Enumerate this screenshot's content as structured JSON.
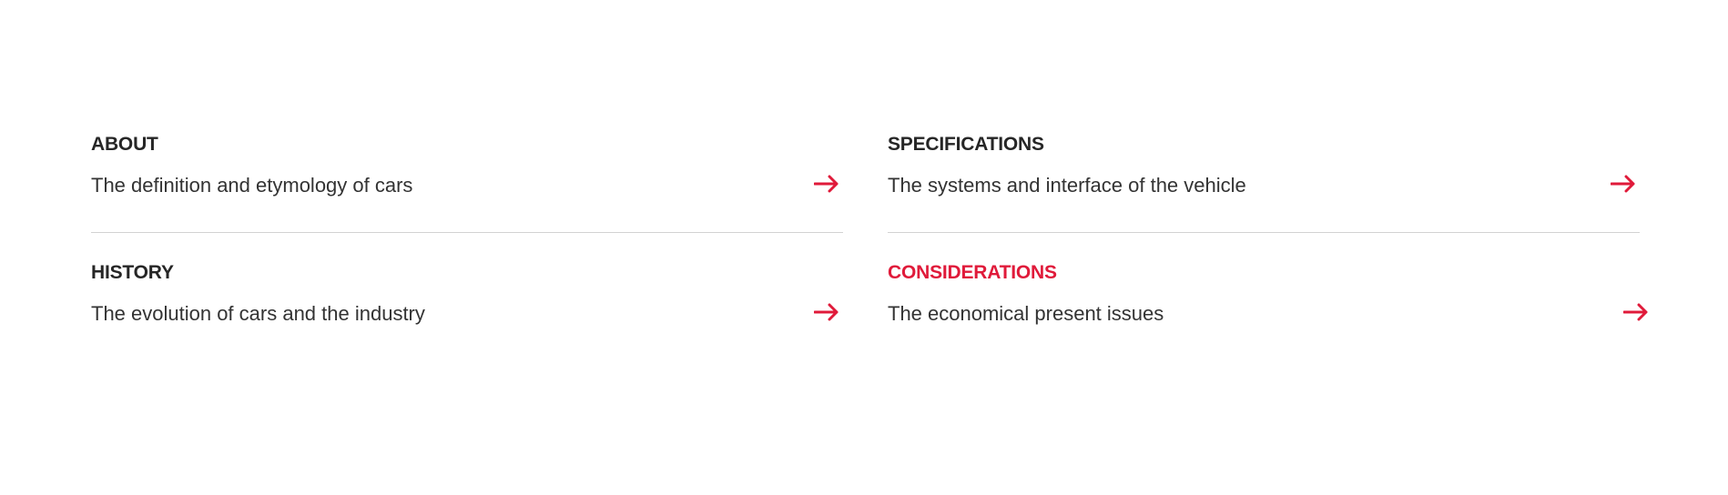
{
  "sections": [
    {
      "id": "about",
      "title": "ABOUT",
      "description": "The definition and etymology of cars",
      "icon": "arrow-right-icon",
      "active": false
    },
    {
      "id": "specifications",
      "title": "SPECIFICATIONS",
      "description": "The systems and interface of the vehicle",
      "icon": "arrow-right-icon",
      "active": false
    },
    {
      "id": "history",
      "title": "HISTORY",
      "description": "The evolution of cars and the industry",
      "icon": "arrow-right-icon",
      "active": false
    },
    {
      "id": "considerations",
      "title": "CONSIDERATIONS",
      "description": "The economical present issues",
      "icon": "arrow-right-icon",
      "active": true
    }
  ],
  "colors": {
    "accent": "#e01a3a",
    "text": "#2a2a2a",
    "divider": "#d2d2d2",
    "background": "#ffffff"
  }
}
